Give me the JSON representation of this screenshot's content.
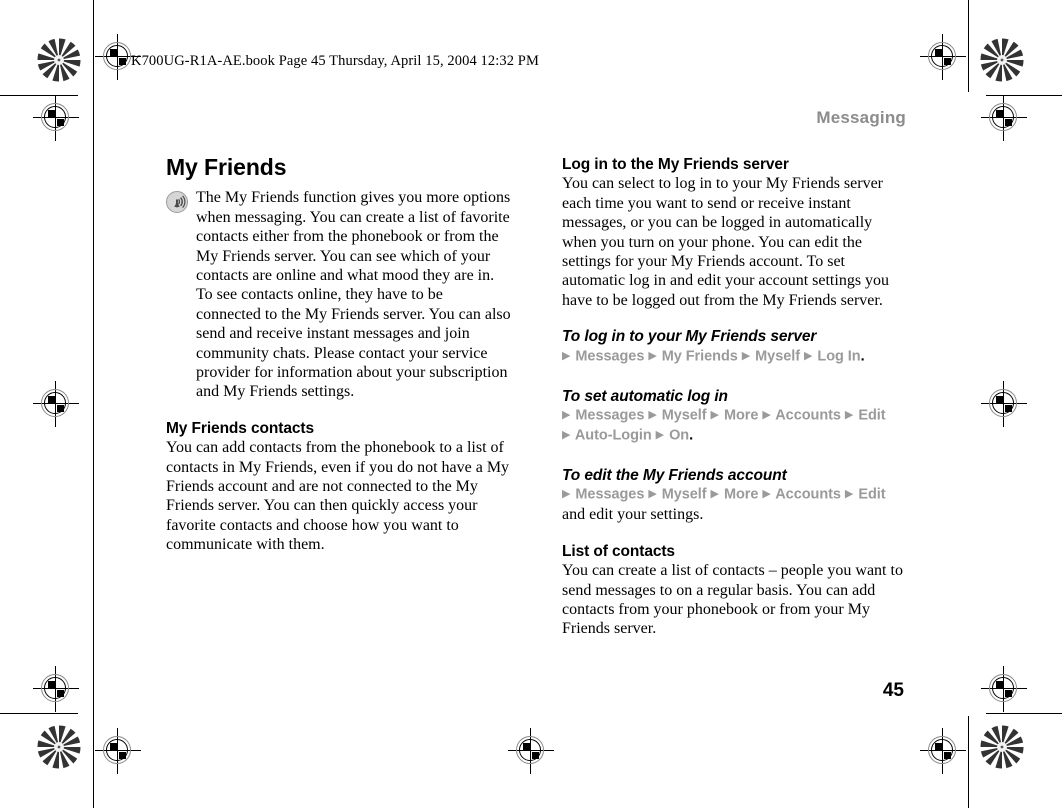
{
  "file_stamp": "K700UG-R1A-AE.book  Page 45  Thursday, April 15, 2004  12:32 PM",
  "running_head": "Messaging",
  "folio": "45",
  "icons": {
    "note": "signal-wave-icon",
    "arrow": "▶"
  },
  "colors": {
    "running_head": "#8c8c8c",
    "nav_path": "#9a9a9a",
    "body_text": "#000000"
  },
  "left_column": {
    "title": "My Friends",
    "lead_paragraph": "The My Friends function gives you more options when messaging. You can create a list of favorite contacts either from the phonebook or from the My Friends server. You can see which of your contacts are online and what mood they are in. To see contacts online, they have to be connected to the My Friends server. You can also send and receive instant messages and join community chats. Please contact your service provider for information about your subscription and My Friends settings.",
    "section_heading": "My Friends contacts",
    "section_paragraph": "You can add contacts from the phonebook to a list of contacts in My Friends, even if you do not have a My Friends account and are not connected to the My Friends server. You can then quickly access your favorite contacts and choose how you want to communicate with them."
  },
  "right_column": {
    "heading_1": "Log in to the My Friends server",
    "paragraph_1": "You can select to log in to your My Friends server each time you want to send or receive instant messages, or you can be logged in automatically when you turn on your phone. You can edit the settings for your My Friends account. To set automatic log in and edit your account settings you have to be logged out from the My Friends server.",
    "task_1": {
      "heading": "To log in to your My Friends server",
      "path_line_1": "Messages ▶ My Friends ▶ Myself ▶ Log In",
      "path_steps_1": [
        "Messages",
        "My Friends",
        "Myself",
        "Log In"
      ],
      "terminator": "."
    },
    "task_2": {
      "heading": "To set automatic log in",
      "path_steps_1": [
        "Messages",
        "Myself",
        "More",
        "Accounts",
        "Edit"
      ],
      "path_steps_2": [
        "Auto-Login",
        "On"
      ],
      "terminator": "."
    },
    "task_3": {
      "heading": "To edit the My Friends account",
      "path_steps_1": [
        "Messages",
        "Myself",
        "More",
        "Accounts",
        "Edit"
      ],
      "trailing_text": "and edit your settings."
    },
    "heading_2": "List of contacts",
    "paragraph_2": "You can create a list of contacts – people you want to send messages to on a regular basis. You can add contacts from your phonebook or from your My Friends server."
  }
}
